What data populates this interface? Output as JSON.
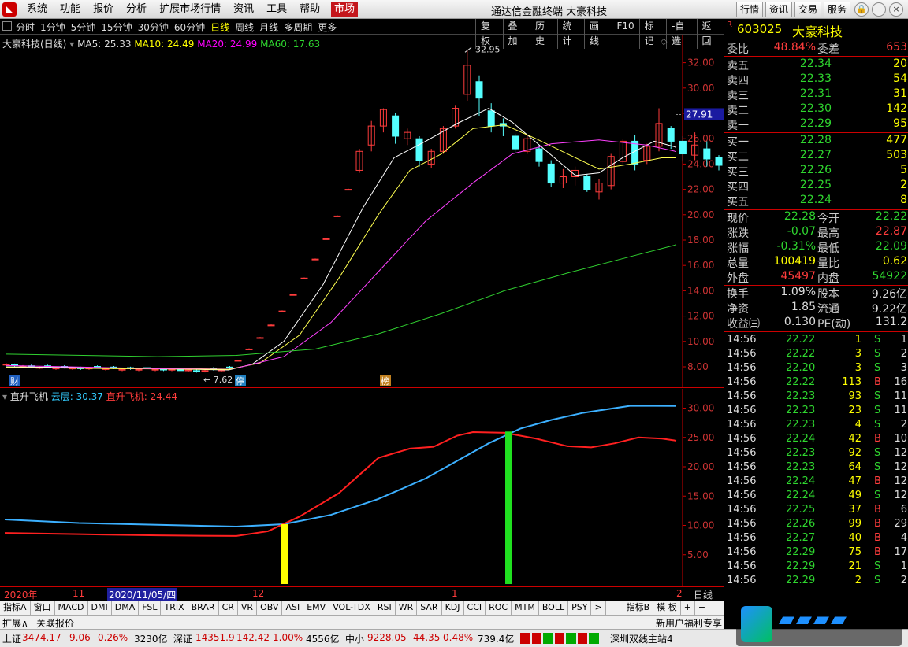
{
  "menubar": {
    "items": [
      "系统",
      "功能",
      "报价",
      "分析",
      "扩展市场行情",
      "资讯",
      "工具",
      "帮助"
    ],
    "market_tab": "市场",
    "title": "通达信金融终端 大豪科技",
    "right_buttons": [
      "行情",
      "资讯",
      "交易",
      "服务"
    ]
  },
  "toolbar": {
    "periods": [
      "分时",
      "1分钟",
      "5分钟",
      "15分钟",
      "30分钟",
      "60分钟",
      "日线",
      "周线",
      "月线",
      "多周期",
      "更多"
    ],
    "active_period": "日线",
    "tools": [
      "复权",
      "叠加",
      "历史",
      "统计",
      "画线",
      "F10",
      "标记",
      "-自选",
      "返回"
    ]
  },
  "main": {
    "legend": {
      "name": "大豪科技(日线)",
      "ma5": "MA5: 25.33",
      "ma10": "MA10: 24.49",
      "ma20": "MA20: 24.99",
      "ma60": "MA60: 17.63"
    },
    "y_labels": [
      "32.00",
      "30.00",
      "28.00",
      "26.00",
      "24.00",
      "22.00",
      "20.00",
      "18.00",
      "16.00",
      "14.00",
      "12.00",
      "10.00",
      "8.00"
    ],
    "price_tag": "27.91",
    "high_label": "32.95",
    "low_label": "7.62",
    "markers": [
      "财",
      "停",
      "榜"
    ]
  },
  "sub": {
    "legend": {
      "name": "直升飞机",
      "cloud": "云层: 30.37",
      "heli": "直升飞机: 24.44"
    },
    "y_labels": [
      "30.00",
      "25.00",
      "20.00",
      "15.00",
      "10.00",
      "5.00"
    ]
  },
  "axis": {
    "labels": [
      "2020年",
      "11",
      "2020/11/05/四",
      "12",
      "1",
      "2"
    ],
    "right": "日线"
  },
  "idxtabs": [
    "指标A",
    "窗口",
    "MACD",
    "DMI",
    "DMA",
    "FSL",
    "TRIX",
    "BRAR",
    "CR",
    "VR",
    "OBV",
    "ASI",
    "EMV",
    "VOL-TDX",
    "RSI",
    "WR",
    "SAR",
    "KDJ",
    "CCI",
    "ROC",
    "MTM",
    "BOLL",
    "PSY",
    ">",
    "指标B",
    "模 板",
    "+",
    "−"
  ],
  "extbar": {
    "left": [
      "扩展∧",
      "关联报价"
    ],
    "right": "新用户福利专享"
  },
  "status": {
    "sh_label": "上证",
    "sh": "3474.17",
    "sh_chg": "9.06",
    "sh_pct": "0.26%",
    "sh_amt": "3230亿",
    "sz_label": "深证",
    "sz": "14351.9",
    "sz_chg": "142.42",
    "sz_pct": "1.00%",
    "sz_amt": "4556亿",
    "zx_label": "中小",
    "zx": "9228.05",
    "zx_chg": "44.35",
    "zx_pct": "0.48%",
    "zx_amt": "739.4亿",
    "site": "深圳双线主站4"
  },
  "stock": {
    "code": "603025",
    "name": "大豪科技",
    "r_badge": "R"
  },
  "quote": {
    "weibi": {
      "label": "委比",
      "pct": "48.84%",
      "label2": "委差",
      "val": "653"
    },
    "sell": [
      {
        "l": "卖五",
        "p": "22.34",
        "v": "20"
      },
      {
        "l": "卖四",
        "p": "22.33",
        "v": "54"
      },
      {
        "l": "卖三",
        "p": "22.31",
        "v": "31"
      },
      {
        "l": "卖二",
        "p": "22.30",
        "v": "142"
      },
      {
        "l": "卖一",
        "p": "22.29",
        "v": "95"
      }
    ],
    "buy": [
      {
        "l": "买一",
        "p": "22.28",
        "v": "477"
      },
      {
        "l": "买二",
        "p": "22.27",
        "v": "503"
      },
      {
        "l": "买三",
        "p": "22.26",
        "v": "5"
      },
      {
        "l": "买四",
        "p": "22.25",
        "v": "2"
      },
      {
        "l": "买五",
        "p": "22.24",
        "v": "8"
      }
    ],
    "stats": [
      {
        "l1": "现价",
        "v1": "22.28",
        "l2": "今开",
        "v2": "22.22",
        "c1": "green",
        "c2": "green"
      },
      {
        "l1": "涨跌",
        "v1": "-0.07",
        "l2": "最高",
        "v2": "22.87",
        "c1": "green",
        "c2": "red"
      },
      {
        "l1": "涨幅",
        "v1": "-0.31%",
        "l2": "最低",
        "v2": "22.09",
        "c1": "green",
        "c2": "green"
      },
      {
        "l1": "总量",
        "v1": "100419",
        "l2": "量比",
        "v2": "0.62",
        "c1": "yellow",
        "c2": "yellow"
      },
      {
        "l1": "外盘",
        "v1": "45497",
        "l2": "内盘",
        "v2": "54922",
        "c1": "red",
        "c2": "green"
      }
    ],
    "stats2": [
      {
        "l1": "换手",
        "v1": "1.09%",
        "l2": "股本",
        "v2": "9.26亿"
      },
      {
        "l1": "净资",
        "v1": "1.85",
        "l2": "流通",
        "v2": "9.22亿"
      },
      {
        "l1": "收益㈢",
        "v1": "0.130",
        "l2": "PE(动)",
        "v2": "131.2"
      }
    ]
  },
  "ticks": [
    {
      "t": "14:56",
      "p": "22.22",
      "v": "1",
      "d": "S",
      "n": "1"
    },
    {
      "t": "14:56",
      "p": "22.22",
      "v": "3",
      "d": "S",
      "n": "2"
    },
    {
      "t": "14:56",
      "p": "22.20",
      "v": "3",
      "d": "S",
      "n": "3"
    },
    {
      "t": "14:56",
      "p": "22.22",
      "v": "113",
      "d": "B",
      "n": "16"
    },
    {
      "t": "14:56",
      "p": "22.23",
      "v": "93",
      "d": "S",
      "n": "11"
    },
    {
      "t": "14:56",
      "p": "22.23",
      "v": "23",
      "d": "S",
      "n": "11"
    },
    {
      "t": "14:56",
      "p": "22.23",
      "v": "4",
      "d": "S",
      "n": "2"
    },
    {
      "t": "14:56",
      "p": "22.24",
      "v": "42",
      "d": "B",
      "n": "10"
    },
    {
      "t": "14:56",
      "p": "22.23",
      "v": "92",
      "d": "S",
      "n": "12"
    },
    {
      "t": "14:56",
      "p": "22.23",
      "v": "64",
      "d": "S",
      "n": "12"
    },
    {
      "t": "14:56",
      "p": "22.24",
      "v": "47",
      "d": "B",
      "n": "12"
    },
    {
      "t": "14:56",
      "p": "22.24",
      "v": "49",
      "d": "S",
      "n": "12"
    },
    {
      "t": "14:56",
      "p": "22.25",
      "v": "37",
      "d": "B",
      "n": "6"
    },
    {
      "t": "14:56",
      "p": "22.26",
      "v": "99",
      "d": "B",
      "n": "29"
    },
    {
      "t": "14:56",
      "p": "22.27",
      "v": "40",
      "d": "B",
      "n": "4"
    },
    {
      "t": "14:56",
      "p": "22.29",
      "v": "75",
      "d": "B",
      "n": "17"
    },
    {
      "t": "14:56",
      "p": "22.29",
      "v": "21",
      "d": "S",
      "n": "1"
    },
    {
      "t": "14:56",
      "p": "22.29",
      "v": "2",
      "d": "S",
      "n": "2"
    }
  ],
  "colors": {
    "up": "#ff3c3c",
    "down": "#54ffff",
    "ma5": "#ffffff",
    "ma10": "#ffff50",
    "ma20": "#ff40ff",
    "ma60": "#30d030"
  }
}
